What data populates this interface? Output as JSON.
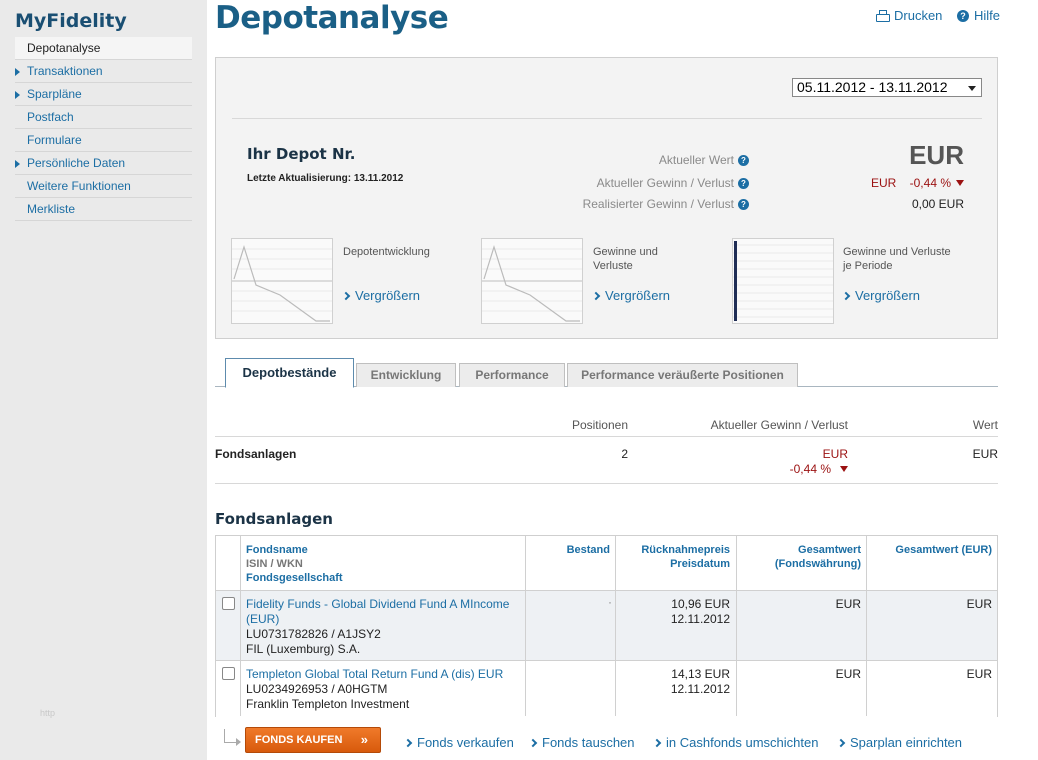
{
  "sidebar": {
    "brand": "MyFidelity",
    "items": [
      {
        "label": "Depotanalyse",
        "active": true,
        "arrow": false
      },
      {
        "label": "Transaktionen",
        "active": false,
        "arrow": true
      },
      {
        "label": "Sparpläne",
        "active": false,
        "arrow": true
      },
      {
        "label": "Postfach",
        "active": false,
        "arrow": false
      },
      {
        "label": "Formulare",
        "active": false,
        "arrow": false
      },
      {
        "label": "Persönliche Daten",
        "active": false,
        "arrow": true
      },
      {
        "label": "Weitere Funktionen",
        "active": false,
        "arrow": false
      },
      {
        "label": "Merkliste",
        "active": false,
        "arrow": false
      }
    ],
    "footer": "http"
  },
  "header": {
    "title": "Depotanalyse",
    "print_label": "Drucken",
    "help_label": "Hilfe"
  },
  "overview": {
    "date_range": "05.11.2012 - 13.11.2012",
    "depot_label": "Ihr Depot Nr.",
    "last_update": "Letzte Aktualisierung: 13.11.2012",
    "current_value_label": "Aktueller Wert",
    "current_value": "EUR",
    "current_gain_label": "Aktueller Gewinn / Verlust",
    "current_gain_currency": "EUR",
    "current_gain_pct": "-0,44 %",
    "realized_gain_label": "Realisierter Gewinn / Verlust",
    "realized_gain": "0,00 EUR",
    "thumbnails": [
      {
        "label": "Depotentwicklung",
        "link": "Vergrößern"
      },
      {
        "label": "Gewinne und Verluste",
        "link": "Vergrößern"
      },
      {
        "label": "Gewinne und Verluste je Periode",
        "link": "Vergrößern"
      }
    ]
  },
  "tabs": [
    {
      "label": "Depotbestände",
      "active": true
    },
    {
      "label": "Entwicklung",
      "active": false
    },
    {
      "label": "Performance",
      "active": false
    },
    {
      "label": "Performance veräußerte Positionen",
      "active": false
    }
  ],
  "summary": {
    "headers": {
      "positions": "Positionen",
      "gain": "Aktueller Gewinn / Verlust",
      "value": "Wert"
    },
    "row": {
      "name": "Fondsanlagen",
      "positions": "2",
      "gain_currency": "EUR",
      "gain_pct": "-0,44 %",
      "value": "EUR"
    }
  },
  "funds": {
    "title": "Fondsanlagen",
    "headers": {
      "name": "Fondsname",
      "isin": "ISIN / WKN",
      "company": "Fondsgesellschaft",
      "holding": "Bestand",
      "price": "Rücknahmepreis",
      "price_date": "Preisdatum",
      "total_fund_cur": "Gesamtwert",
      "total_fund_cur_sub": "(Fondswährung)",
      "total_eur": "Gesamtwert (EUR)"
    },
    "rows": [
      {
        "name_line1": "Fidelity Funds - Global Dividend Fund A MIncome",
        "name_line2": "(EUR)",
        "isin": "LU0731782826 / A1JSY2",
        "company": "FIL (Luxemburg) S.A.",
        "holding": "·",
        "price": "10,96 EUR",
        "price_date": "12.11.2012",
        "total_fund_cur": "EUR",
        "total_eur": "EUR"
      },
      {
        "name_line1": "Templeton Global Total Return Fund A (dis) EUR",
        "name_line2": "",
        "isin": "LU0234926953 / A0HGTM",
        "company": "Franklin Templeton Investment",
        "holding": "",
        "price": "14,13 EUR",
        "price_date": "12.11.2012",
        "total_fund_cur": "EUR",
        "total_eur": "EUR"
      }
    ]
  },
  "actions": {
    "buy": "FONDS KAUFEN",
    "buy_arrows": "»",
    "sell": "Fonds verkaufen",
    "switch": "Fonds tauschen",
    "cash": "in Cashfonds umschichten",
    "plan": "Sparplan einrichten"
  },
  "colors": {
    "brand": "#1a4f73",
    "link": "#1c6ea4",
    "negative": "#9b1111",
    "button": "#e4681a"
  }
}
